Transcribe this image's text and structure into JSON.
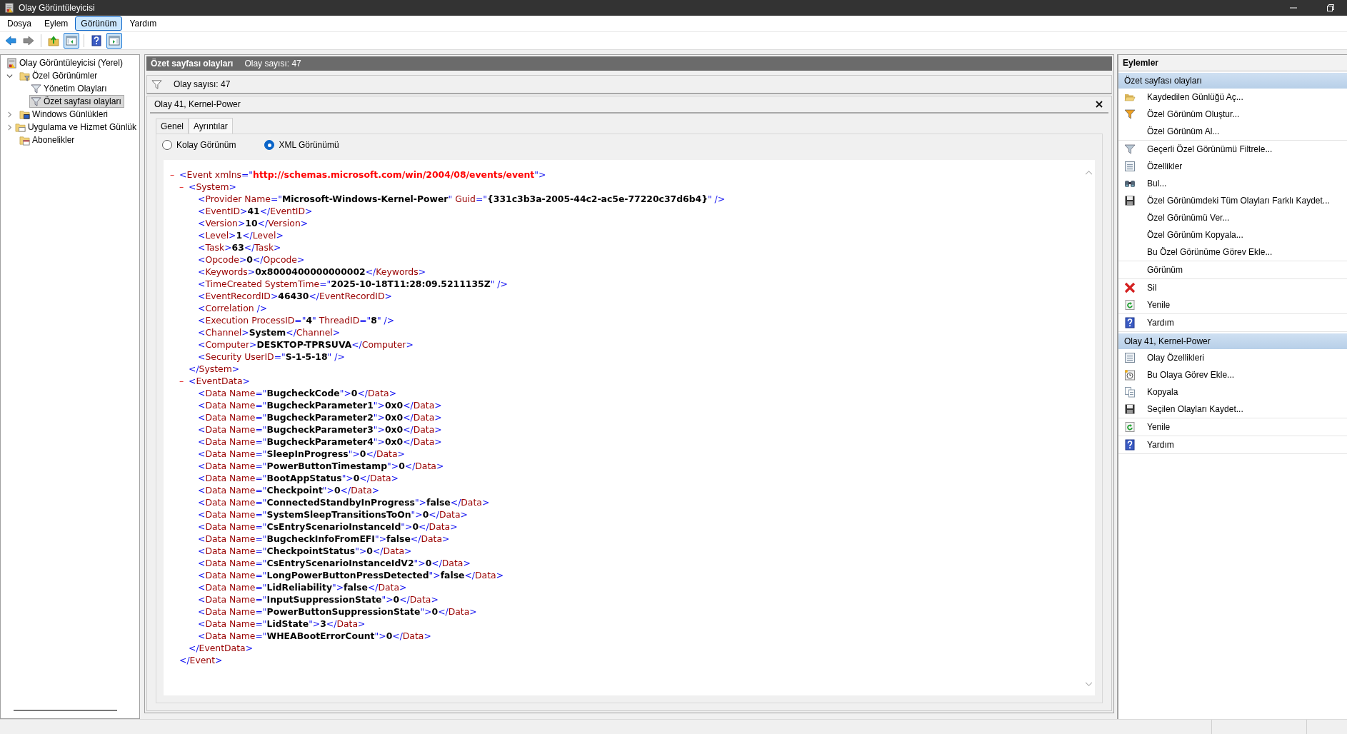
{
  "window": {
    "title": "Olay Görüntüleyicisi"
  },
  "menu": [
    {
      "label": "Dosya",
      "selected": false
    },
    {
      "label": "Eylem",
      "selected": false
    },
    {
      "label": "Görünüm",
      "selected": true
    },
    {
      "label": "Yardım",
      "selected": false
    }
  ],
  "toolbar": [
    {
      "kind": "back",
      "pressed": false
    },
    {
      "kind": "forward",
      "pressed": false
    },
    {
      "kind": "separator"
    },
    {
      "kind": "up",
      "pressed": false
    },
    {
      "kind": "tree-pane",
      "pressed": true
    },
    {
      "kind": "separator"
    },
    {
      "kind": "help",
      "pressed": false
    },
    {
      "kind": "action-pane",
      "pressed": true
    }
  ],
  "tree": [
    {
      "label": "Olay Görüntüleyicisi (Yerel)",
      "kind": "root",
      "selected": false,
      "children": [
        {
          "label": "Özel Görünümler",
          "kind": "view-folder",
          "expanded": true,
          "selected": false,
          "children": [
            {
              "label": "Yönetim Olayları",
              "kind": "view",
              "selected": false
            },
            {
              "label": "Özet sayfası olayları",
              "kind": "view",
              "selected": true
            }
          ]
        },
        {
          "label": "Windows Günlükleri",
          "kind": "log-folder",
          "expanded": false,
          "selected": false
        },
        {
          "label": "Uygulama ve Hizmet Günlük",
          "kind": "app-folder",
          "expanded": false,
          "selected": false
        },
        {
          "label": "Abonelikler",
          "kind": "subscriptions",
          "selected": false
        }
      ]
    }
  ],
  "center": {
    "title": "Özet sayfası olayları",
    "count": "Olay sayısı: 47",
    "filter_text": "Olay sayısı: 47",
    "event_title": "Olay 41, Kernel-Power",
    "tabs": [
      {
        "label": "Genel",
        "selected": false
      },
      {
        "label": "Ayrıntılar",
        "selected": true
      }
    ],
    "view_options": [
      {
        "label": "Kolay Görünüm",
        "selected": false
      },
      {
        "label": "XML Görünümü",
        "selected": true
      }
    ],
    "xml": {
      "toggle": "–",
      "open": [
        {
          "kind": "mark",
          "text": "<"
        },
        {
          "kind": "name",
          "text": "Event xmlns"
        },
        {
          "kind": "mark",
          "text": "=\""
        },
        {
          "kind": "url",
          "text": "http://schemas.microsoft.com/win/2004/08/events/event"
        },
        {
          "kind": "mark",
          "text": "\">"
        }
      ],
      "children": [
        {
          "toggle": "–",
          "open": [
            {
              "kind": "mark",
              "text": "<"
            },
            {
              "kind": "name",
              "text": "System"
            },
            {
              "kind": "mark",
              "text": ">"
            }
          ],
          "children": [
            {
              "line": [
                {
                  "kind": "mark",
                  "text": "<"
                },
                {
                  "kind": "name",
                  "text": "Provider Name"
                },
                {
                  "kind": "mark",
                  "text": "=\""
                },
                {
                  "kind": "value",
                  "text": "Microsoft-Windows-Kernel-Power"
                },
                {
                  "kind": "mark",
                  "text": "\" "
                },
                {
                  "kind": "name",
                  "text": "Guid"
                },
                {
                  "kind": "mark",
                  "text": "=\""
                },
                {
                  "kind": "value",
                  "text": "{331c3b3a-2005-44c2-ac5e-77220c37d6b4}"
                },
                {
                  "kind": "mark",
                  "text": "\" />"
                }
              ]
            },
            {
              "line": [
                {
                  "kind": "mark",
                  "text": "<"
                },
                {
                  "kind": "name",
                  "text": "EventID"
                },
                {
                  "kind": "mark",
                  "text": ">"
                },
                {
                  "kind": "value",
                  "text": "41"
                },
                {
                  "kind": "mark",
                  "text": "</"
                },
                {
                  "kind": "name",
                  "text": "EventID"
                },
                {
                  "kind": "mark",
                  "text": ">"
                }
              ]
            },
            {
              "line": [
                {
                  "kind": "mark",
                  "text": "<"
                },
                {
                  "kind": "name",
                  "text": "Version"
                },
                {
                  "kind": "mark",
                  "text": ">"
                },
                {
                  "kind": "value",
                  "text": "10"
                },
                {
                  "kind": "mark",
                  "text": "</"
                },
                {
                  "kind": "name",
                  "text": "Version"
                },
                {
                  "kind": "mark",
                  "text": ">"
                }
              ]
            },
            {
              "line": [
                {
                  "kind": "mark",
                  "text": "<"
                },
                {
                  "kind": "name",
                  "text": "Level"
                },
                {
                  "kind": "mark",
                  "text": ">"
                },
                {
                  "kind": "value",
                  "text": "1"
                },
                {
                  "kind": "mark",
                  "text": "</"
                },
                {
                  "kind": "name",
                  "text": "Level"
                },
                {
                  "kind": "mark",
                  "text": ">"
                }
              ]
            },
            {
              "line": [
                {
                  "kind": "mark",
                  "text": "<"
                },
                {
                  "kind": "name",
                  "text": "Task"
                },
                {
                  "kind": "mark",
                  "text": ">"
                },
                {
                  "kind": "value",
                  "text": "63"
                },
                {
                  "kind": "mark",
                  "text": "</"
                },
                {
                  "kind": "name",
                  "text": "Task"
                },
                {
                  "kind": "mark",
                  "text": ">"
                }
              ]
            },
            {
              "line": [
                {
                  "kind": "mark",
                  "text": "<"
                },
                {
                  "kind": "name",
                  "text": "Opcode"
                },
                {
                  "kind": "mark",
                  "text": ">"
                },
                {
                  "kind": "value",
                  "text": "0"
                },
                {
                  "kind": "mark",
                  "text": "</"
                },
                {
                  "kind": "name",
                  "text": "Opcode"
                },
                {
                  "kind": "mark",
                  "text": ">"
                }
              ]
            },
            {
              "line": [
                {
                  "kind": "mark",
                  "text": "<"
                },
                {
                  "kind": "name",
                  "text": "Keywords"
                },
                {
                  "kind": "mark",
                  "text": ">"
                },
                {
                  "kind": "value",
                  "text": "0x8000400000000002"
                },
                {
                  "kind": "mark",
                  "text": "</"
                },
                {
                  "kind": "name",
                  "text": "Keywords"
                },
                {
                  "kind": "mark",
                  "text": ">"
                }
              ]
            },
            {
              "line": [
                {
                  "kind": "mark",
                  "text": "<"
                },
                {
                  "kind": "name",
                  "text": "TimeCreated SystemTime"
                },
                {
                  "kind": "mark",
                  "text": "=\""
                },
                {
                  "kind": "value",
                  "text": "2025-10-18T11:28:09.5211135Z"
                },
                {
                  "kind": "mark",
                  "text": "\" />"
                }
              ]
            },
            {
              "line": [
                {
                  "kind": "mark",
                  "text": "<"
                },
                {
                  "kind": "name",
                  "text": "EventRecordID"
                },
                {
                  "kind": "mark",
                  "text": ">"
                },
                {
                  "kind": "value",
                  "text": "46430"
                },
                {
                  "kind": "mark",
                  "text": "</"
                },
                {
                  "kind": "name",
                  "text": "EventRecordID"
                },
                {
                  "kind": "mark",
                  "text": ">"
                }
              ]
            },
            {
              "line": [
                {
                  "kind": "mark",
                  "text": "<"
                },
                {
                  "kind": "name",
                  "text": "Correlation"
                },
                {
                  "kind": "mark",
                  "text": " />"
                }
              ]
            },
            {
              "line": [
                {
                  "kind": "mark",
                  "text": "<"
                },
                {
                  "kind": "name",
                  "text": "Execution ProcessID"
                },
                {
                  "kind": "mark",
                  "text": "=\""
                },
                {
                  "kind": "value",
                  "text": "4"
                },
                {
                  "kind": "mark",
                  "text": "\" "
                },
                {
                  "kind": "name",
                  "text": "ThreadID"
                },
                {
                  "kind": "mark",
                  "text": "=\""
                },
                {
                  "kind": "value",
                  "text": "8"
                },
                {
                  "kind": "mark",
                  "text": "\" />"
                }
              ]
            },
            {
              "line": [
                {
                  "kind": "mark",
                  "text": "<"
                },
                {
                  "kind": "name",
                  "text": "Channel"
                },
                {
                  "kind": "mark",
                  "text": ">"
                },
                {
                  "kind": "value",
                  "text": "System"
                },
                {
                  "kind": "mark",
                  "text": "</"
                },
                {
                  "kind": "name",
                  "text": "Channel"
                },
                {
                  "kind": "mark",
                  "text": ">"
                }
              ]
            },
            {
              "line": [
                {
                  "kind": "mark",
                  "text": "<"
                },
                {
                  "kind": "name",
                  "text": "Computer"
                },
                {
                  "kind": "mark",
                  "text": ">"
                },
                {
                  "kind": "value",
                  "text": "DESKTOP-TPRSUVA"
                },
                {
                  "kind": "mark",
                  "text": "</"
                },
                {
                  "kind": "name",
                  "text": "Computer"
                },
                {
                  "kind": "mark",
                  "text": ">"
                }
              ]
            },
            {
              "line": [
                {
                  "kind": "mark",
                  "text": "<"
                },
                {
                  "kind": "name",
                  "text": "Security UserID"
                },
                {
                  "kind": "mark",
                  "text": "=\""
                },
                {
                  "kind": "value",
                  "text": "S-1-5-18"
                },
                {
                  "kind": "mark",
                  "text": "\" />"
                }
              ]
            }
          ],
          "close": [
            {
              "kind": "mark",
              "text": "</"
            },
            {
              "kind": "name",
              "text": "System"
            },
            {
              "kind": "mark",
              "text": ">"
            }
          ]
        },
        {
          "toggle": "–",
          "open": [
            {
              "kind": "mark",
              "text": "<"
            },
            {
              "kind": "name",
              "text": "EventData"
            },
            {
              "kind": "mark",
              "text": ">"
            }
          ],
          "children": [
            {
              "line": [
                {
                  "kind": "mark",
                  "text": "<"
                },
                {
                  "kind": "name",
                  "text": "Data Name"
                },
                {
                  "kind": "mark",
                  "text": "=\""
                },
                {
                  "kind": "value",
                  "text": "BugcheckCode"
                },
                {
                  "kind": "mark",
                  "text": "\">"
                },
                {
                  "kind": "value",
                  "text": "0"
                },
                {
                  "kind": "mark",
                  "text": "</"
                },
                {
                  "kind": "name",
                  "text": "Data"
                },
                {
                  "kind": "mark",
                  "text": ">"
                }
              ]
            },
            {
              "line": [
                {
                  "kind": "mark",
                  "text": "<"
                },
                {
                  "kind": "name",
                  "text": "Data Name"
                },
                {
                  "kind": "mark",
                  "text": "=\""
                },
                {
                  "kind": "value",
                  "text": "BugcheckParameter1"
                },
                {
                  "kind": "mark",
                  "text": "\">"
                },
                {
                  "kind": "value",
                  "text": "0x0"
                },
                {
                  "kind": "mark",
                  "text": "</"
                },
                {
                  "kind": "name",
                  "text": "Data"
                },
                {
                  "kind": "mark",
                  "text": ">"
                }
              ]
            },
            {
              "line": [
                {
                  "kind": "mark",
                  "text": "<"
                },
                {
                  "kind": "name",
                  "text": "Data Name"
                },
                {
                  "kind": "mark",
                  "text": "=\""
                },
                {
                  "kind": "value",
                  "text": "BugcheckParameter2"
                },
                {
                  "kind": "mark",
                  "text": "\">"
                },
                {
                  "kind": "value",
                  "text": "0x0"
                },
                {
                  "kind": "mark",
                  "text": "</"
                },
                {
                  "kind": "name",
                  "text": "Data"
                },
                {
                  "kind": "mark",
                  "text": ">"
                }
              ]
            },
            {
              "line": [
                {
                  "kind": "mark",
                  "text": "<"
                },
                {
                  "kind": "name",
                  "text": "Data Name"
                },
                {
                  "kind": "mark",
                  "text": "=\""
                },
                {
                  "kind": "value",
                  "text": "BugcheckParameter3"
                },
                {
                  "kind": "mark",
                  "text": "\">"
                },
                {
                  "kind": "value",
                  "text": "0x0"
                },
                {
                  "kind": "mark",
                  "text": "</"
                },
                {
                  "kind": "name",
                  "text": "Data"
                },
                {
                  "kind": "mark",
                  "text": ">"
                }
              ]
            },
            {
              "line": [
                {
                  "kind": "mark",
                  "text": "<"
                },
                {
                  "kind": "name",
                  "text": "Data Name"
                },
                {
                  "kind": "mark",
                  "text": "=\""
                },
                {
                  "kind": "value",
                  "text": "BugcheckParameter4"
                },
                {
                  "kind": "mark",
                  "text": "\">"
                },
                {
                  "kind": "value",
                  "text": "0x0"
                },
                {
                  "kind": "mark",
                  "text": "</"
                },
                {
                  "kind": "name",
                  "text": "Data"
                },
                {
                  "kind": "mark",
                  "text": ">"
                }
              ]
            },
            {
              "line": [
                {
                  "kind": "mark",
                  "text": "<"
                },
                {
                  "kind": "name",
                  "text": "Data Name"
                },
                {
                  "kind": "mark",
                  "text": "=\""
                },
                {
                  "kind": "value",
                  "text": "SleepInProgress"
                },
                {
                  "kind": "mark",
                  "text": "\">"
                },
                {
                  "kind": "value",
                  "text": "0"
                },
                {
                  "kind": "mark",
                  "text": "</"
                },
                {
                  "kind": "name",
                  "text": "Data"
                },
                {
                  "kind": "mark",
                  "text": ">"
                }
              ]
            },
            {
              "line": [
                {
                  "kind": "mark",
                  "text": "<"
                },
                {
                  "kind": "name",
                  "text": "Data Name"
                },
                {
                  "kind": "mark",
                  "text": "=\""
                },
                {
                  "kind": "value",
                  "text": "PowerButtonTimestamp"
                },
                {
                  "kind": "mark",
                  "text": "\">"
                },
                {
                  "kind": "value",
                  "text": "0"
                },
                {
                  "kind": "mark",
                  "text": "</"
                },
                {
                  "kind": "name",
                  "text": "Data"
                },
                {
                  "kind": "mark",
                  "text": ">"
                }
              ]
            },
            {
              "line": [
                {
                  "kind": "mark",
                  "text": "<"
                },
                {
                  "kind": "name",
                  "text": "Data Name"
                },
                {
                  "kind": "mark",
                  "text": "=\""
                },
                {
                  "kind": "value",
                  "text": "BootAppStatus"
                },
                {
                  "kind": "mark",
                  "text": "\">"
                },
                {
                  "kind": "value",
                  "text": "0"
                },
                {
                  "kind": "mark",
                  "text": "</"
                },
                {
                  "kind": "name",
                  "text": "Data"
                },
                {
                  "kind": "mark",
                  "text": ">"
                }
              ]
            },
            {
              "line": [
                {
                  "kind": "mark",
                  "text": "<"
                },
                {
                  "kind": "name",
                  "text": "Data Name"
                },
                {
                  "kind": "mark",
                  "text": "=\""
                },
                {
                  "kind": "value",
                  "text": "Checkpoint"
                },
                {
                  "kind": "mark",
                  "text": "\">"
                },
                {
                  "kind": "value",
                  "text": "0"
                },
                {
                  "kind": "mark",
                  "text": "</"
                },
                {
                  "kind": "name",
                  "text": "Data"
                },
                {
                  "kind": "mark",
                  "text": ">"
                }
              ]
            },
            {
              "line": [
                {
                  "kind": "mark",
                  "text": "<"
                },
                {
                  "kind": "name",
                  "text": "Data Name"
                },
                {
                  "kind": "mark",
                  "text": "=\""
                },
                {
                  "kind": "value",
                  "text": "ConnectedStandbyInProgress"
                },
                {
                  "kind": "mark",
                  "text": "\">"
                },
                {
                  "kind": "value",
                  "text": "false"
                },
                {
                  "kind": "mark",
                  "text": "</"
                },
                {
                  "kind": "name",
                  "text": "Data"
                },
                {
                  "kind": "mark",
                  "text": ">"
                }
              ]
            },
            {
              "line": [
                {
                  "kind": "mark",
                  "text": "<"
                },
                {
                  "kind": "name",
                  "text": "Data Name"
                },
                {
                  "kind": "mark",
                  "text": "=\""
                },
                {
                  "kind": "value",
                  "text": "SystemSleepTransitionsToOn"
                },
                {
                  "kind": "mark",
                  "text": "\">"
                },
                {
                  "kind": "value",
                  "text": "0"
                },
                {
                  "kind": "mark",
                  "text": "</"
                },
                {
                  "kind": "name",
                  "text": "Data"
                },
                {
                  "kind": "mark",
                  "text": ">"
                }
              ]
            },
            {
              "line": [
                {
                  "kind": "mark",
                  "text": "<"
                },
                {
                  "kind": "name",
                  "text": "Data Name"
                },
                {
                  "kind": "mark",
                  "text": "=\""
                },
                {
                  "kind": "value",
                  "text": "CsEntryScenarioInstanceId"
                },
                {
                  "kind": "mark",
                  "text": "\">"
                },
                {
                  "kind": "value",
                  "text": "0"
                },
                {
                  "kind": "mark",
                  "text": "</"
                },
                {
                  "kind": "name",
                  "text": "Data"
                },
                {
                  "kind": "mark",
                  "text": ">"
                }
              ]
            },
            {
              "line": [
                {
                  "kind": "mark",
                  "text": "<"
                },
                {
                  "kind": "name",
                  "text": "Data Name"
                },
                {
                  "kind": "mark",
                  "text": "=\""
                },
                {
                  "kind": "value",
                  "text": "BugcheckInfoFromEFI"
                },
                {
                  "kind": "mark",
                  "text": "\">"
                },
                {
                  "kind": "value",
                  "text": "false"
                },
                {
                  "kind": "mark",
                  "text": "</"
                },
                {
                  "kind": "name",
                  "text": "Data"
                },
                {
                  "kind": "mark",
                  "text": ">"
                }
              ]
            },
            {
              "line": [
                {
                  "kind": "mark",
                  "text": "<"
                },
                {
                  "kind": "name",
                  "text": "Data Name"
                },
                {
                  "kind": "mark",
                  "text": "=\""
                },
                {
                  "kind": "value",
                  "text": "CheckpointStatus"
                },
                {
                  "kind": "mark",
                  "text": "\">"
                },
                {
                  "kind": "value",
                  "text": "0"
                },
                {
                  "kind": "mark",
                  "text": "</"
                },
                {
                  "kind": "name",
                  "text": "Data"
                },
                {
                  "kind": "mark",
                  "text": ">"
                }
              ]
            },
            {
              "line": [
                {
                  "kind": "mark",
                  "text": "<"
                },
                {
                  "kind": "name",
                  "text": "Data Name"
                },
                {
                  "kind": "mark",
                  "text": "=\""
                },
                {
                  "kind": "value",
                  "text": "CsEntryScenarioInstanceIdV2"
                },
                {
                  "kind": "mark",
                  "text": "\">"
                },
                {
                  "kind": "value",
                  "text": "0"
                },
                {
                  "kind": "mark",
                  "text": "</"
                },
                {
                  "kind": "name",
                  "text": "Data"
                },
                {
                  "kind": "mark",
                  "text": ">"
                }
              ]
            },
            {
              "line": [
                {
                  "kind": "mark",
                  "text": "<"
                },
                {
                  "kind": "name",
                  "text": "Data Name"
                },
                {
                  "kind": "mark",
                  "text": "=\""
                },
                {
                  "kind": "value",
                  "text": "LongPowerButtonPressDetected"
                },
                {
                  "kind": "mark",
                  "text": "\">"
                },
                {
                  "kind": "value",
                  "text": "false"
                },
                {
                  "kind": "mark",
                  "text": "</"
                },
                {
                  "kind": "name",
                  "text": "Data"
                },
                {
                  "kind": "mark",
                  "text": ">"
                }
              ]
            },
            {
              "line": [
                {
                  "kind": "mark",
                  "text": "<"
                },
                {
                  "kind": "name",
                  "text": "Data Name"
                },
                {
                  "kind": "mark",
                  "text": "=\""
                },
                {
                  "kind": "value",
                  "text": "LidReliability"
                },
                {
                  "kind": "mark",
                  "text": "\">"
                },
                {
                  "kind": "value",
                  "text": "false"
                },
                {
                  "kind": "mark",
                  "text": "</"
                },
                {
                  "kind": "name",
                  "text": "Data"
                },
                {
                  "kind": "mark",
                  "text": ">"
                }
              ]
            },
            {
              "line": [
                {
                  "kind": "mark",
                  "text": "<"
                },
                {
                  "kind": "name",
                  "text": "Data Name"
                },
                {
                  "kind": "mark",
                  "text": "=\""
                },
                {
                  "kind": "value",
                  "text": "InputSuppressionState"
                },
                {
                  "kind": "mark",
                  "text": "\">"
                },
                {
                  "kind": "value",
                  "text": "0"
                },
                {
                  "kind": "mark",
                  "text": "</"
                },
                {
                  "kind": "name",
                  "text": "Data"
                },
                {
                  "kind": "mark",
                  "text": ">"
                }
              ]
            },
            {
              "line": [
                {
                  "kind": "mark",
                  "text": "<"
                },
                {
                  "kind": "name",
                  "text": "Data Name"
                },
                {
                  "kind": "mark",
                  "text": "=\""
                },
                {
                  "kind": "value",
                  "text": "PowerButtonSuppressionState"
                },
                {
                  "kind": "mark",
                  "text": "\">"
                },
                {
                  "kind": "value",
                  "text": "0"
                },
                {
                  "kind": "mark",
                  "text": "</"
                },
                {
                  "kind": "name",
                  "text": "Data"
                },
                {
                  "kind": "mark",
                  "text": ">"
                }
              ]
            },
            {
              "line": [
                {
                  "kind": "mark",
                  "text": "<"
                },
                {
                  "kind": "name",
                  "text": "Data Name"
                },
                {
                  "kind": "mark",
                  "text": "=\""
                },
                {
                  "kind": "value",
                  "text": "LidState"
                },
                {
                  "kind": "mark",
                  "text": "\">"
                },
                {
                  "kind": "value",
                  "text": "3"
                },
                {
                  "kind": "mark",
                  "text": "</"
                },
                {
                  "kind": "name",
                  "text": "Data"
                },
                {
                  "kind": "mark",
                  "text": ">"
                }
              ]
            },
            {
              "line": [
                {
                  "kind": "mark",
                  "text": "<"
                },
                {
                  "kind": "name",
                  "text": "Data Name"
                },
                {
                  "kind": "mark",
                  "text": "=\""
                },
                {
                  "kind": "value",
                  "text": "WHEABootErrorCount"
                },
                {
                  "kind": "mark",
                  "text": "\">"
                },
                {
                  "kind": "value",
                  "text": "0"
                },
                {
                  "kind": "mark",
                  "text": "</"
                },
                {
                  "kind": "name",
                  "text": "Data"
                },
                {
                  "kind": "mark",
                  "text": ">"
                }
              ]
            }
          ],
          "close": [
            {
              "kind": "mark",
              "text": "</"
            },
            {
              "kind": "name",
              "text": "EventData"
            },
            {
              "kind": "mark",
              "text": ">"
            }
          ]
        }
      ],
      "close": [
        {
          "kind": "mark",
          "text": "</"
        },
        {
          "kind": "name",
          "text": "Event"
        },
        {
          "kind": "mark",
          "text": ">"
        }
      ]
    }
  },
  "actions": {
    "title": "Eylemler",
    "sections": [
      {
        "title": "Özet sayfası olayları",
        "groups": [
          [
            {
              "label": "Kaydedilen Günlüğü Aç...",
              "kind": "open"
            },
            {
              "label": "Özel Görünüm Oluştur...",
              "kind": "create-view"
            },
            {
              "label": "Özel Görünüm Al...",
              "kind": "plain"
            }
          ],
          [
            {
              "label": "Geçerli Özel Görünümü Filtrele...",
              "kind": "filter"
            },
            {
              "label": "Özellikler",
              "kind": "properties"
            },
            {
              "label": "Bul...",
              "kind": "find"
            },
            {
              "label": "Özel Görünümdeki Tüm Olayları Farklı Kaydet...",
              "kind": "save"
            },
            {
              "label": "Özel Görünümü Ver...",
              "kind": "plain"
            },
            {
              "label": "Özel Görünüm Kopyala...",
              "kind": "plain"
            },
            {
              "label": "Bu Özel Görünüme Görev Ekle...",
              "kind": "plain"
            }
          ],
          [
            {
              "label": "Görünüm",
              "kind": "plain"
            }
          ],
          [
            {
              "label": "Sil",
              "kind": "delete"
            },
            {
              "label": "Yenile",
              "kind": "refresh"
            }
          ],
          [
            {
              "label": "Yardım",
              "kind": "help"
            }
          ]
        ]
      },
      {
        "title": "Olay 41, Kernel-Power",
        "groups": [
          [
            {
              "label": "Olay Özellikleri",
              "kind": "properties"
            },
            {
              "label": "Bu Olaya Görev Ekle...",
              "kind": "task"
            },
            {
              "label": "Kopyala",
              "kind": "copy"
            },
            {
              "label": "Seçilen Olayları Kaydet...",
              "kind": "save"
            }
          ],
          [
            {
              "label": "Yenile",
              "kind": "refresh"
            }
          ],
          [
            {
              "label": "Yardım",
              "kind": "help"
            }
          ]
        ]
      }
    ]
  }
}
